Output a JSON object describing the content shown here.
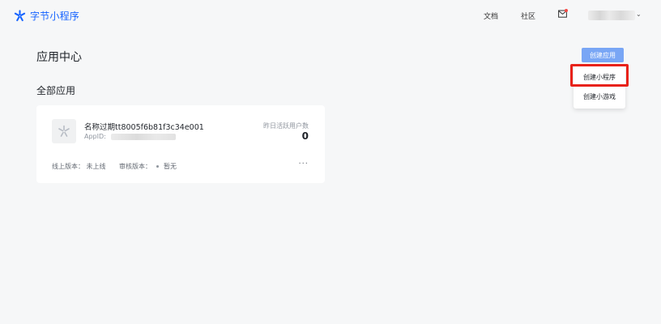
{
  "nav": {
    "logo_text": "字节小程序",
    "docs": "文档",
    "community": "社区",
    "user_chevron": "⌄"
  },
  "page": {
    "title": "应用中心",
    "section_title": "全部应用"
  },
  "create_button": {
    "label": "创建应用",
    "menu": [
      "创建小程序",
      "创建小游戏"
    ]
  },
  "app": {
    "name": "名称过期tt8005f6b81f3c34e001",
    "appid_label": "AppID:",
    "dau_label": "昨日活跃用户数",
    "dau_value": "0",
    "online_version": "线上版本：  未上线",
    "review_version_label": "审核版本：",
    "review_version_value": "暂无",
    "more": "···"
  },
  "colors": {
    "brand": "#1664ff",
    "button": "#79a6f5",
    "highlight": "#e8221a"
  }
}
